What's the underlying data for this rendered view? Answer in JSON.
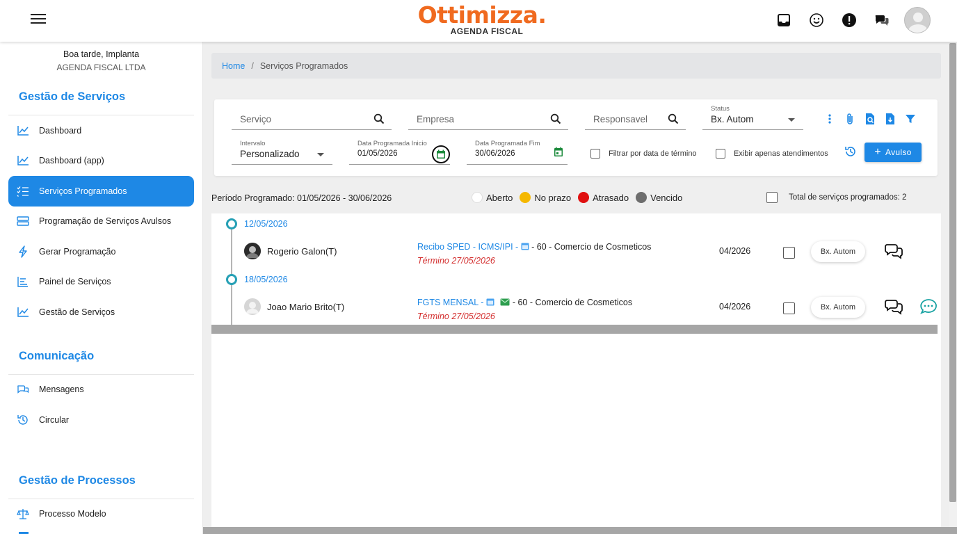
{
  "header": {
    "brand": "Ottimizza.",
    "subtitle": "AGENDA FISCAL",
    "icons": [
      "inbox-icon",
      "smiley-icon",
      "alert-icon",
      "chat-icon",
      "user-avatar"
    ]
  },
  "sidebar": {
    "greeting": "Boa tarde, Implanta",
    "company": "AGENDA FISCAL LTDA",
    "sections": [
      {
        "title": "Gestão de Serviços",
        "items": [
          {
            "label": "Dashboard",
            "icon": "line-chart-icon"
          },
          {
            "label": "Dashboard (app)",
            "icon": "line-chart-icon"
          },
          {
            "label": "Serviços Programados",
            "icon": "checklist-icon",
            "active": true
          },
          {
            "label": "Programação de Serviços Avulsos",
            "icon": "stack-icon"
          },
          {
            "label": "Gerar Programação",
            "icon": "bolt-icon"
          },
          {
            "label": "Painel de Serviços",
            "icon": "bar-list-icon"
          },
          {
            "label": "Gestão de Serviços",
            "icon": "line-chart-icon"
          }
        ]
      },
      {
        "title": "Comunicação",
        "items": [
          {
            "label": "Mensagens",
            "icon": "chat-icon"
          },
          {
            "label": "Circular",
            "icon": "history-icon"
          }
        ]
      },
      {
        "title": "Gestão de Processos",
        "items": [
          {
            "label": "Processo Modelo",
            "icon": "scale-icon"
          }
        ]
      }
    ]
  },
  "breadcrumb": {
    "home": "Home",
    "separator": "/",
    "current": "Serviços Programados"
  },
  "filters": {
    "servico_placeholder": "Serviço",
    "empresa_placeholder": "Empresa",
    "responsavel_placeholder": "Responsavel",
    "status_label": "Status",
    "status_value": "Bx. Autom",
    "intervalo_label": "Intervalo",
    "intervalo_value": "Personalizado",
    "inicio_label": "Data Programada Inicio",
    "inicio_value": "01/05/2026",
    "fim_label": "Data Programada Fim",
    "fim_value": "30/06/2026",
    "filtrar_termino": "Filtrar por data de término",
    "exibir_atendimentos": "Exibir apenas atendimentos",
    "avulso_button": "Avulso"
  },
  "summary": {
    "period": "Período Programado: 01/05/2026 - 30/06/2026",
    "legend": [
      {
        "label": "Aberto",
        "color": "#ffffff"
      },
      {
        "label": "No prazo",
        "color": "#f5b800"
      },
      {
        "label": "Atrasado",
        "color": "#e01010"
      },
      {
        "label": "Vencido",
        "color": "#6d6d6d"
      }
    ],
    "total": "Total de serviços programados: 2"
  },
  "timeline": [
    {
      "date": "12/05/2026",
      "user": "Rogerio Galon(T)",
      "service": "Recibo SPED - ICMS/IPI",
      "company": "- 60 - Comercio de Cosmeticos",
      "termino": "Término 27/05/2026",
      "competencia": "04/2026",
      "status_chip": "Bx. Autom"
    },
    {
      "date": "18/05/2026",
      "user": "Joao Mario Brito(T)",
      "service": "FGTS MENSAL",
      "company": "- 60 - Comercio de Cosmeticos",
      "termino": "Término 27/05/2026",
      "competencia": "04/2026",
      "status_chip": "Bx. Autom"
    }
  ]
}
